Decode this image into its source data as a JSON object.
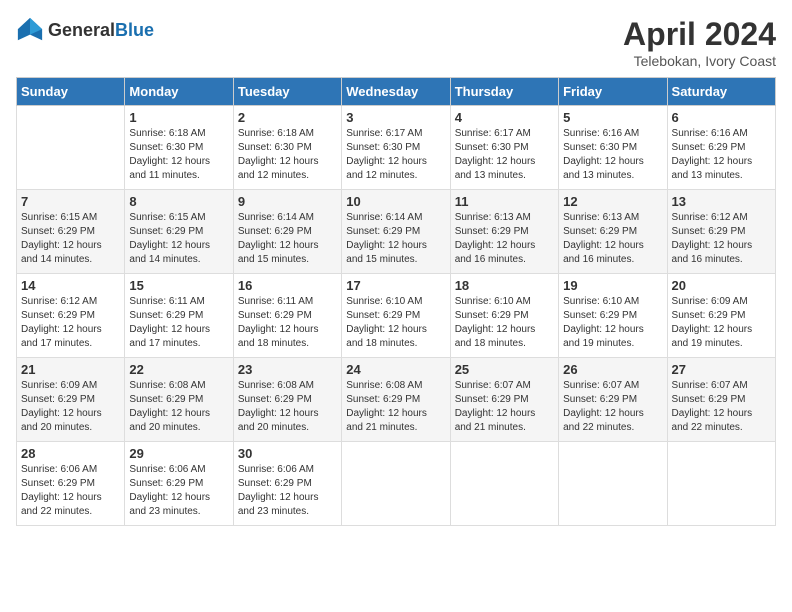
{
  "header": {
    "logo_general": "General",
    "logo_blue": "Blue",
    "title": "April 2024",
    "subtitle": "Telebokan, Ivory Coast"
  },
  "days_of_week": [
    "Sunday",
    "Monday",
    "Tuesday",
    "Wednesday",
    "Thursday",
    "Friday",
    "Saturday"
  ],
  "weeks": [
    [
      {
        "day": "",
        "sunrise": "",
        "sunset": "",
        "daylight": ""
      },
      {
        "day": "1",
        "sunrise": "Sunrise: 6:18 AM",
        "sunset": "Sunset: 6:30 PM",
        "daylight": "Daylight: 12 hours and 11 minutes."
      },
      {
        "day": "2",
        "sunrise": "Sunrise: 6:18 AM",
        "sunset": "Sunset: 6:30 PM",
        "daylight": "Daylight: 12 hours and 12 minutes."
      },
      {
        "day": "3",
        "sunrise": "Sunrise: 6:17 AM",
        "sunset": "Sunset: 6:30 PM",
        "daylight": "Daylight: 12 hours and 12 minutes."
      },
      {
        "day": "4",
        "sunrise": "Sunrise: 6:17 AM",
        "sunset": "Sunset: 6:30 PM",
        "daylight": "Daylight: 12 hours and 13 minutes."
      },
      {
        "day": "5",
        "sunrise": "Sunrise: 6:16 AM",
        "sunset": "Sunset: 6:30 PM",
        "daylight": "Daylight: 12 hours and 13 minutes."
      },
      {
        "day": "6",
        "sunrise": "Sunrise: 6:16 AM",
        "sunset": "Sunset: 6:29 PM",
        "daylight": "Daylight: 12 hours and 13 minutes."
      }
    ],
    [
      {
        "day": "7",
        "sunrise": "Sunrise: 6:15 AM",
        "sunset": "Sunset: 6:29 PM",
        "daylight": "Daylight: 12 hours and 14 minutes."
      },
      {
        "day": "8",
        "sunrise": "Sunrise: 6:15 AM",
        "sunset": "Sunset: 6:29 PM",
        "daylight": "Daylight: 12 hours and 14 minutes."
      },
      {
        "day": "9",
        "sunrise": "Sunrise: 6:14 AM",
        "sunset": "Sunset: 6:29 PM",
        "daylight": "Daylight: 12 hours and 15 minutes."
      },
      {
        "day": "10",
        "sunrise": "Sunrise: 6:14 AM",
        "sunset": "Sunset: 6:29 PM",
        "daylight": "Daylight: 12 hours and 15 minutes."
      },
      {
        "day": "11",
        "sunrise": "Sunrise: 6:13 AM",
        "sunset": "Sunset: 6:29 PM",
        "daylight": "Daylight: 12 hours and 16 minutes."
      },
      {
        "day": "12",
        "sunrise": "Sunrise: 6:13 AM",
        "sunset": "Sunset: 6:29 PM",
        "daylight": "Daylight: 12 hours and 16 minutes."
      },
      {
        "day": "13",
        "sunrise": "Sunrise: 6:12 AM",
        "sunset": "Sunset: 6:29 PM",
        "daylight": "Daylight: 12 hours and 16 minutes."
      }
    ],
    [
      {
        "day": "14",
        "sunrise": "Sunrise: 6:12 AM",
        "sunset": "Sunset: 6:29 PM",
        "daylight": "Daylight: 12 hours and 17 minutes."
      },
      {
        "day": "15",
        "sunrise": "Sunrise: 6:11 AM",
        "sunset": "Sunset: 6:29 PM",
        "daylight": "Daylight: 12 hours and 17 minutes."
      },
      {
        "day": "16",
        "sunrise": "Sunrise: 6:11 AM",
        "sunset": "Sunset: 6:29 PM",
        "daylight": "Daylight: 12 hours and 18 minutes."
      },
      {
        "day": "17",
        "sunrise": "Sunrise: 6:10 AM",
        "sunset": "Sunset: 6:29 PM",
        "daylight": "Daylight: 12 hours and 18 minutes."
      },
      {
        "day": "18",
        "sunrise": "Sunrise: 6:10 AM",
        "sunset": "Sunset: 6:29 PM",
        "daylight": "Daylight: 12 hours and 18 minutes."
      },
      {
        "day": "19",
        "sunrise": "Sunrise: 6:10 AM",
        "sunset": "Sunset: 6:29 PM",
        "daylight": "Daylight: 12 hours and 19 minutes."
      },
      {
        "day": "20",
        "sunrise": "Sunrise: 6:09 AM",
        "sunset": "Sunset: 6:29 PM",
        "daylight": "Daylight: 12 hours and 19 minutes."
      }
    ],
    [
      {
        "day": "21",
        "sunrise": "Sunrise: 6:09 AM",
        "sunset": "Sunset: 6:29 PM",
        "daylight": "Daylight: 12 hours and 20 minutes."
      },
      {
        "day": "22",
        "sunrise": "Sunrise: 6:08 AM",
        "sunset": "Sunset: 6:29 PM",
        "daylight": "Daylight: 12 hours and 20 minutes."
      },
      {
        "day": "23",
        "sunrise": "Sunrise: 6:08 AM",
        "sunset": "Sunset: 6:29 PM",
        "daylight": "Daylight: 12 hours and 20 minutes."
      },
      {
        "day": "24",
        "sunrise": "Sunrise: 6:08 AM",
        "sunset": "Sunset: 6:29 PM",
        "daylight": "Daylight: 12 hours and 21 minutes."
      },
      {
        "day": "25",
        "sunrise": "Sunrise: 6:07 AM",
        "sunset": "Sunset: 6:29 PM",
        "daylight": "Daylight: 12 hours and 21 minutes."
      },
      {
        "day": "26",
        "sunrise": "Sunrise: 6:07 AM",
        "sunset": "Sunset: 6:29 PM",
        "daylight": "Daylight: 12 hours and 22 minutes."
      },
      {
        "day": "27",
        "sunrise": "Sunrise: 6:07 AM",
        "sunset": "Sunset: 6:29 PM",
        "daylight": "Daylight: 12 hours and 22 minutes."
      }
    ],
    [
      {
        "day": "28",
        "sunrise": "Sunrise: 6:06 AM",
        "sunset": "Sunset: 6:29 PM",
        "daylight": "Daylight: 12 hours and 22 minutes."
      },
      {
        "day": "29",
        "sunrise": "Sunrise: 6:06 AM",
        "sunset": "Sunset: 6:29 PM",
        "daylight": "Daylight: 12 hours and 23 minutes."
      },
      {
        "day": "30",
        "sunrise": "Sunrise: 6:06 AM",
        "sunset": "Sunset: 6:29 PM",
        "daylight": "Daylight: 12 hours and 23 minutes."
      },
      {
        "day": "",
        "sunrise": "",
        "sunset": "",
        "daylight": ""
      },
      {
        "day": "",
        "sunrise": "",
        "sunset": "",
        "daylight": ""
      },
      {
        "day": "",
        "sunrise": "",
        "sunset": "",
        "daylight": ""
      },
      {
        "day": "",
        "sunrise": "",
        "sunset": "",
        "daylight": ""
      }
    ]
  ]
}
